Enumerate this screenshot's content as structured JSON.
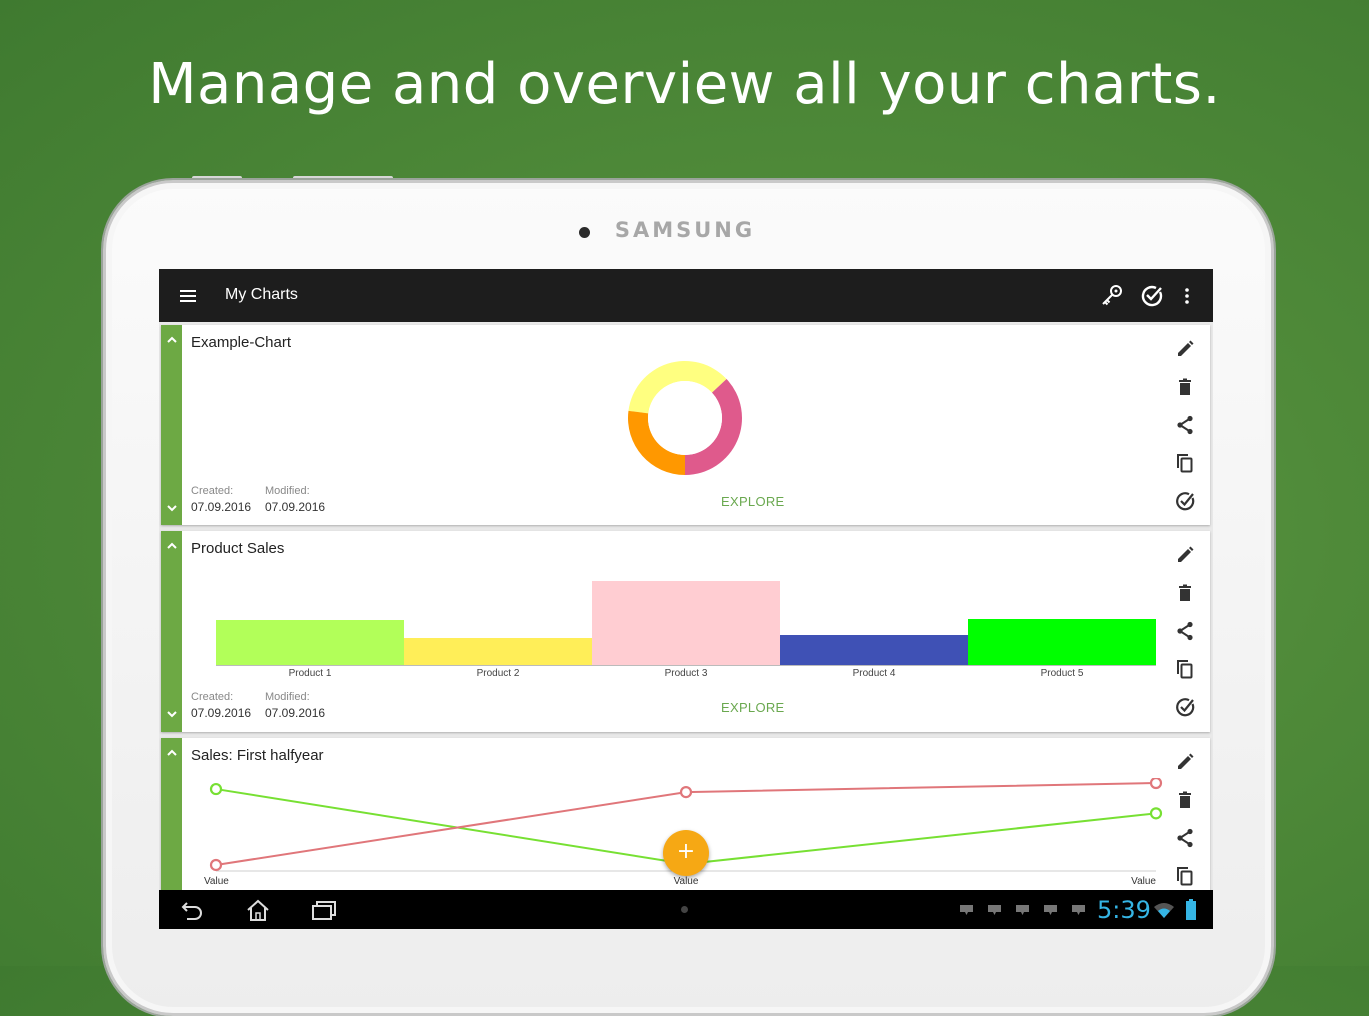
{
  "promo": {
    "headline": "Manage and overview all your charts."
  },
  "device": {
    "brand": "SAMSUNG"
  },
  "appbar": {
    "title": "My Charts",
    "icons": [
      "menu-icon",
      "key-icon",
      "check-circle-icon",
      "more-vert-icon"
    ]
  },
  "cards": [
    {
      "title": "Example-Chart",
      "created_label": "Created:",
      "created": "07.09.2016",
      "modified_label": "Modified:",
      "modified": "07.09.2016",
      "explore": "EXPLORE",
      "chart_data": {
        "type": "pie",
        "donut": true,
        "slices": [
          {
            "value": 36,
            "color": "#ffff80"
          },
          {
            "value": 37,
            "color": "#df5a8c"
          },
          {
            "value": 27,
            "color": "#ff9800"
          }
        ]
      }
    },
    {
      "title": "Product Sales",
      "created_label": "Created:",
      "created": "07.09.2016",
      "modified_label": "Modified:",
      "modified": "07.09.2016",
      "explore": "EXPLORE",
      "chart_data": {
        "type": "bar",
        "categories": [
          "Product 1",
          "Product 2",
          "Product 3",
          "Product 4",
          "Product 5"
        ],
        "values": [
          45,
          27,
          84,
          30,
          46
        ],
        "colors": [
          "#b2ff59",
          "#ffee58",
          "#ffcdd2",
          "#3f51b5",
          "#00ff00"
        ],
        "ylim": [
          0,
          84
        ]
      }
    },
    {
      "title": "Sales: First halfyear",
      "chart_data": {
        "type": "line",
        "x": [
          "Value",
          "Value",
          "Value"
        ],
        "series": [
          {
            "values": [
              76,
              2,
              52
            ],
            "color": "#77e033"
          },
          {
            "values": [
              1,
              73,
              82
            ],
            "color": "#e0767a"
          }
        ],
        "ylim": [
          0,
          82
        ]
      }
    }
  ],
  "actions": [
    "edit-icon",
    "delete-icon",
    "share-icon",
    "copy-icon",
    "check-circle-icon"
  ],
  "fab": {
    "label": "+"
  },
  "statusbar": {
    "time": "5:39"
  }
}
